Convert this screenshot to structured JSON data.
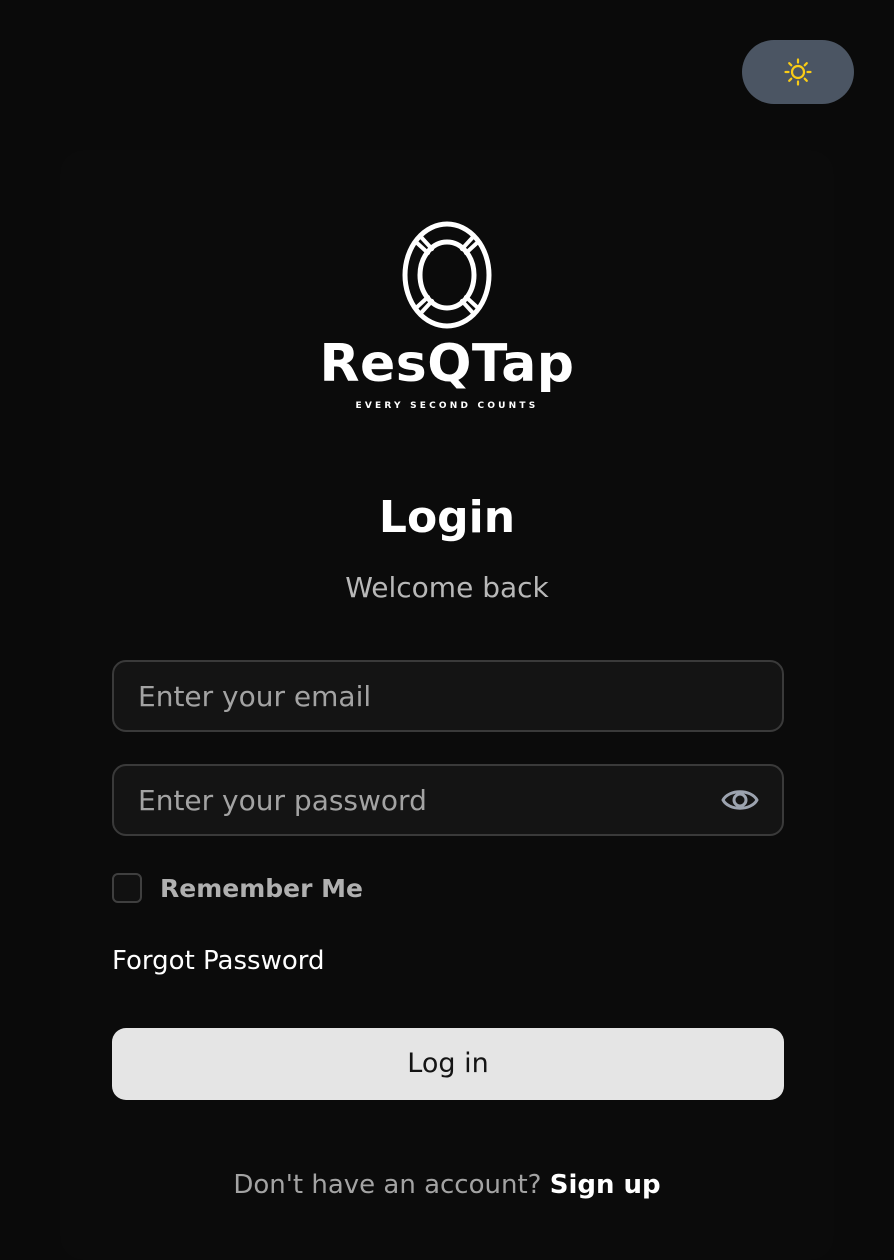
{
  "theme_toggle": {
    "icon": "sun-icon",
    "icon_color": "#facc15",
    "background": "#4b5563"
  },
  "logo": {
    "icon": "lifebuoy-icon",
    "name": "ResQTap",
    "tagline": "EVERY SECOND COUNTS"
  },
  "header": {
    "title": "Login",
    "subtitle": "Welcome back"
  },
  "form": {
    "email_placeholder": "Enter your email",
    "email_value": "",
    "password_placeholder": "Enter your password",
    "password_value": "",
    "password_toggle_icon": "eye-icon",
    "remember_label": "Remember Me",
    "remember_checked": false,
    "forgot_label": "Forgot Password",
    "submit_label": "Log in"
  },
  "footer": {
    "prompt": "Don't have an account?",
    "signup_label": "Sign up"
  }
}
